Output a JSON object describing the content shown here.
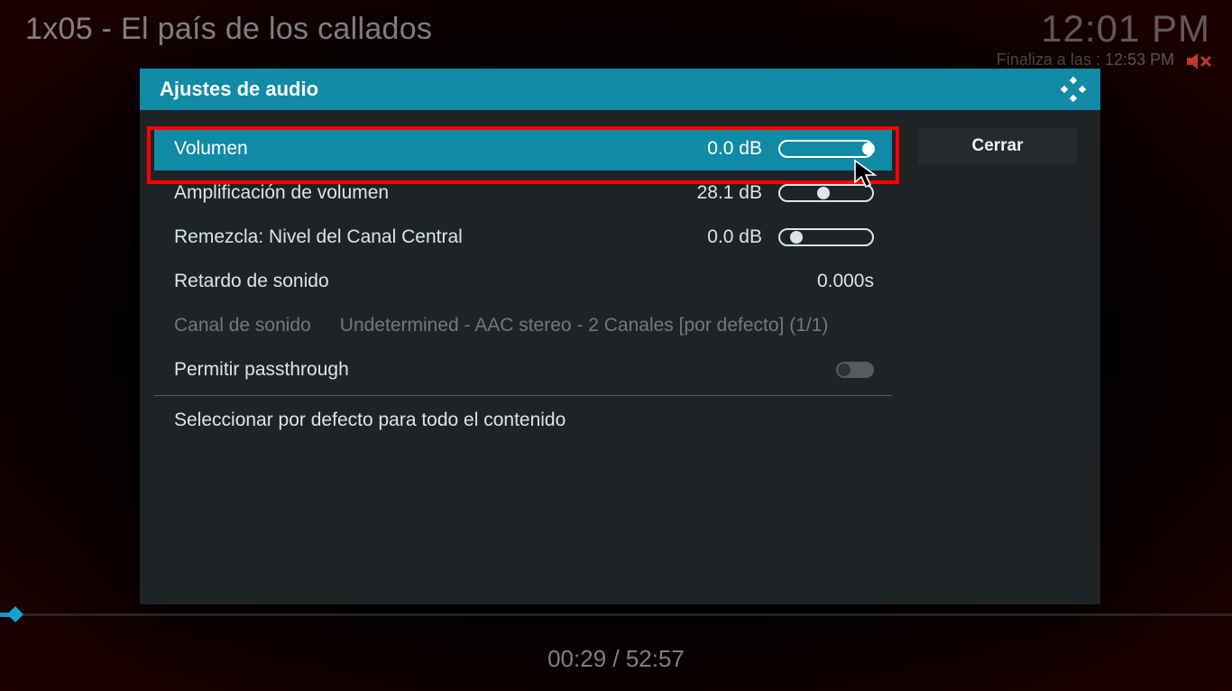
{
  "osd": {
    "title": "1x05 - El país de los callados",
    "clock": "12:01 PM",
    "ends_label": "Finaliza a las : 12:53 PM",
    "time_display": "00:29 / 52:57"
  },
  "dialog": {
    "title": "Ajustes de audio",
    "close_label": "Cerrar"
  },
  "settings": {
    "volume": {
      "label": "Volumen",
      "value": "0.0 dB",
      "slider_pct": 96
    },
    "amp": {
      "label": "Amplificación de volumen",
      "value": "28.1 dB",
      "slider_pct": 47
    },
    "downmix": {
      "label": "Remezcla: Nivel del Canal Central",
      "value": "0.0 dB",
      "slider_pct": 18
    },
    "delay": {
      "label": "Retardo de sonido",
      "value": "0.000s"
    },
    "channel": {
      "label": "Canal de sonido",
      "value": "Undetermined - AAC stereo - 2 Canales [por defecto] (1/1)"
    },
    "passthrough": {
      "label": "Permitir passthrough"
    },
    "defaults": {
      "label": "Seleccionar por defecto para todo el contenido"
    }
  }
}
